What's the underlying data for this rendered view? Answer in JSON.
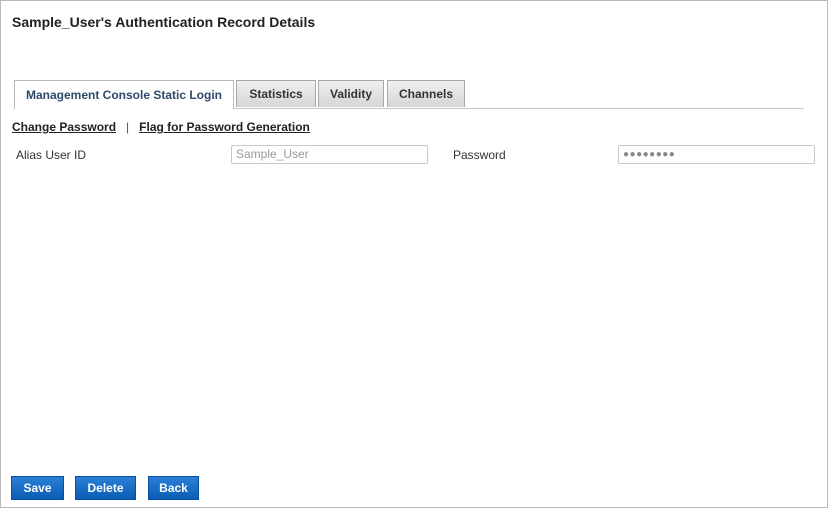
{
  "page": {
    "title": "Sample_User's Authentication Record Details"
  },
  "tabs": [
    {
      "label": "Management Console Static Login",
      "active": true
    },
    {
      "label": "Statistics",
      "active": false
    },
    {
      "label": "Validity",
      "active": false
    },
    {
      "label": "Channels",
      "active": false
    }
  ],
  "links": {
    "change_password": "Change Password",
    "separator": "|",
    "flag_password": "Flag for Password Generation"
  },
  "form": {
    "alias_label": "Alias User ID",
    "alias_value": "Sample_User",
    "password_label": "Password",
    "password_value": "●●●●●●●●"
  },
  "buttons": {
    "save": "Save",
    "delete": "Delete",
    "back": "Back"
  },
  "colors": {
    "button_blue": "#0a5db4",
    "active_tab_text": "#2e4a6b"
  }
}
